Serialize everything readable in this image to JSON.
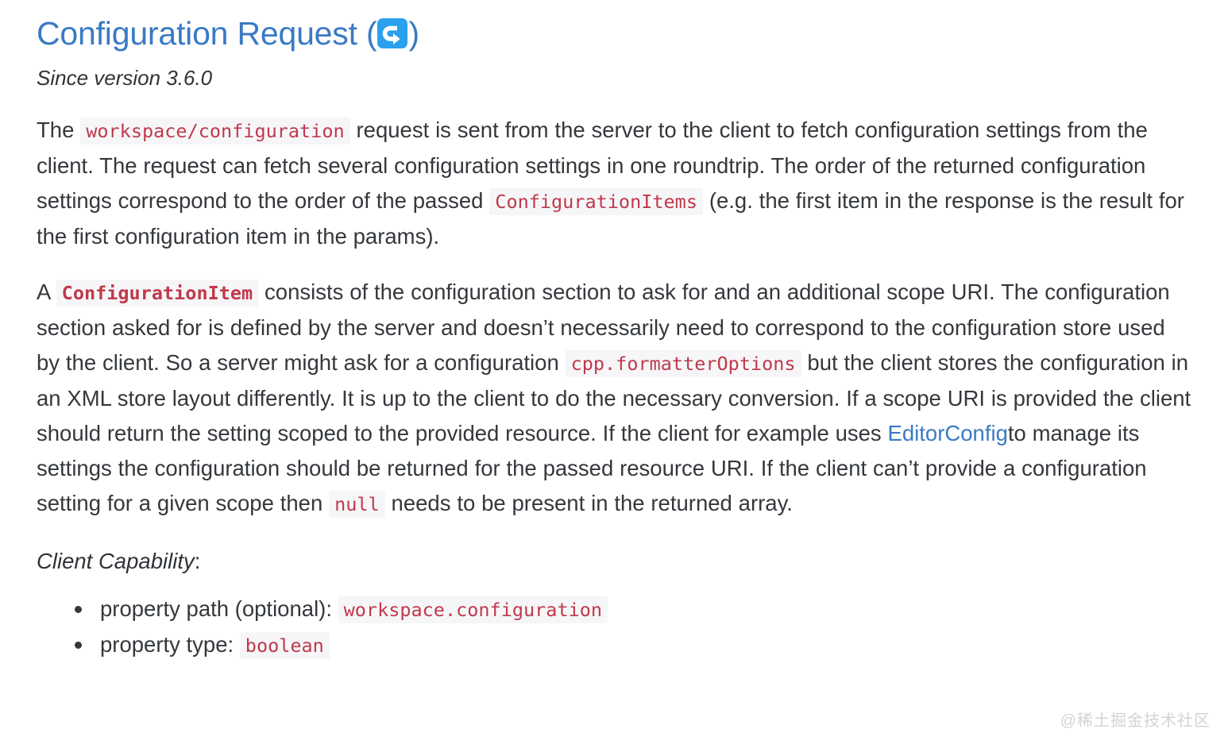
{
  "heading": {
    "title_text": "Configuration Request (",
    "title_close": ")",
    "anchor_icon": "return-arrow-icon",
    "color": "#3a7ac4"
  },
  "since": {
    "text": "Since version 3.6.0"
  },
  "paragraph_1": {
    "part_1": "The",
    "code_1": "workspace/configuration",
    "part_2": "request is sent from the server to the client to fetch configuration settings from the client. The request can fetch several configuration settings in one roundtrip. The order of the returned configuration settings correspond to the order of the passed",
    "code_2": "ConfigurationItems",
    "part_3": "(e.g. the first item in the response is the result for the first configuration item in the params)."
  },
  "paragraph_2": {
    "part_1": "A",
    "code_1": "ConfigurationItem",
    "part_2": "consists of the configuration section to ask for and an additional scope URI. The configuration section asked for is defined by the server and doesn’t necessarily need to correspond to the configuration store used by the client. So a server might ask for a configuration",
    "code_2": "cpp.formatterOptions",
    "part_3": "but the client stores the configuration in an XML store layout differently. It is up to the client to do the necessary conversion. If a scope URI is provided the client should return the setting scoped to the provided resource. If the client for example uses",
    "link_text": "EditorConfig",
    "part_4": "to manage its settings the configuration should be returned for the passed resource URI. If the client can’t provide a configuration setting for a given scope then",
    "code_3": "null",
    "part_5": "needs to be present in the returned array."
  },
  "client_capability": {
    "label": "Client Capability",
    "colon": ":",
    "items": [
      {
        "label": "property path (optional):",
        "code": "workspace.configuration"
      },
      {
        "label": "property type:",
        "code": "boolean"
      }
    ]
  },
  "watermark": {
    "text": "@稀土掘金技术社区"
  },
  "colors": {
    "link": "#3a7ac4",
    "code_text": "#c0394b",
    "code_bg": "#f6f6f8",
    "body_text": "#34383c",
    "icon_bg": "#2aa0ee",
    "watermark": "#d3d3d6"
  }
}
